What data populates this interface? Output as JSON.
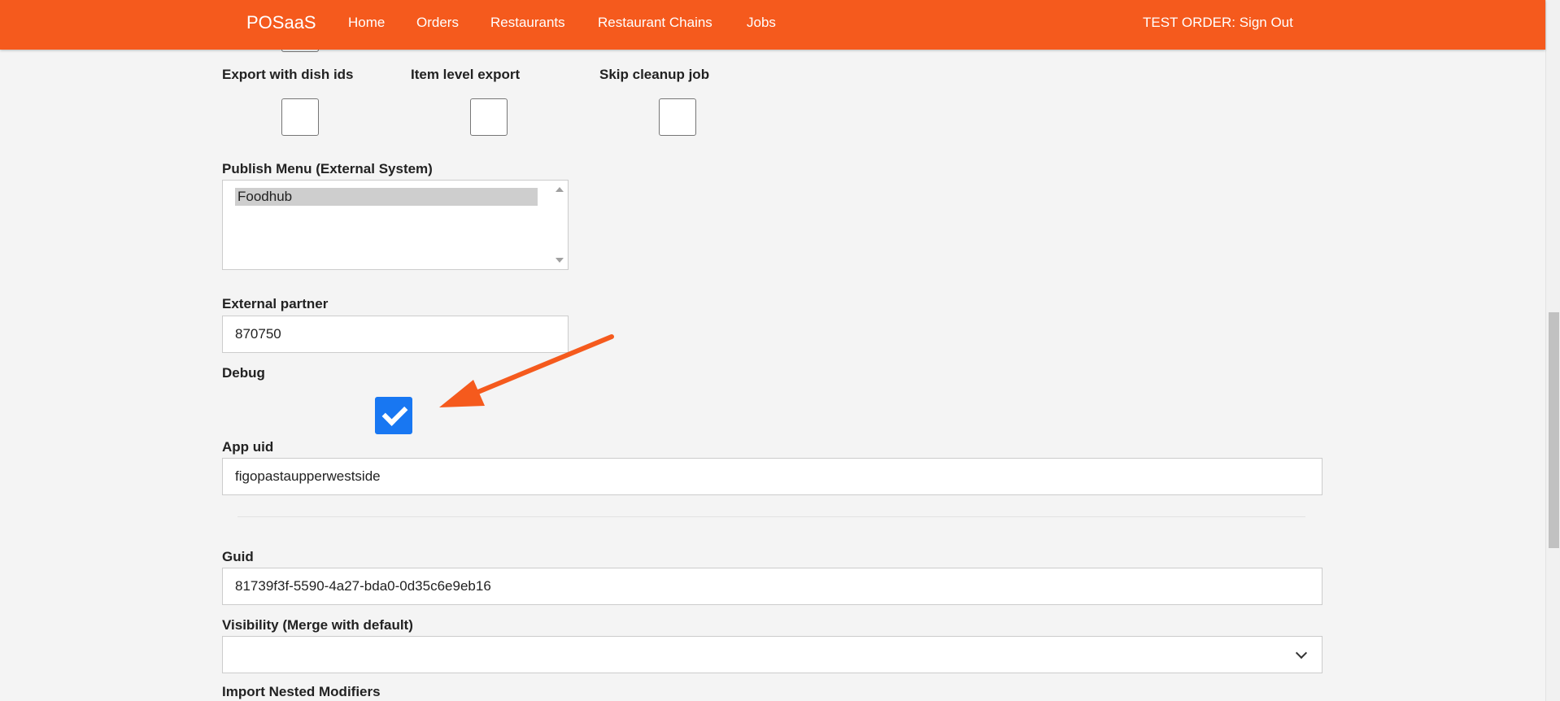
{
  "nav": {
    "brand": "POSaaS",
    "links": [
      "Home",
      "Orders",
      "Restaurants",
      "Restaurant Chains",
      "Jobs"
    ],
    "account": "TEST ORDER: Sign Out"
  },
  "form": {
    "export_with_dish_ids": {
      "label": "Export with dish ids",
      "checked": false
    },
    "item_level_export": {
      "label": "Item level export",
      "checked": false
    },
    "skip_cleanup_job": {
      "label": "Skip cleanup job",
      "checked": false
    },
    "publish_menu": {
      "label": "Publish Menu (External System)",
      "options": [
        "Foodhub"
      ],
      "selected": "Foodhub"
    },
    "external_partner": {
      "label": "External partner",
      "value": "870750"
    },
    "debug": {
      "label": "Debug",
      "checked": true
    },
    "app_uid": {
      "label": "App uid",
      "value": "figopastaupperwestside"
    },
    "guid": {
      "label": "Guid",
      "value": "81739f3f-5590-4a27-bda0-0d35c6e9eb16"
    },
    "visibility": {
      "label": "Visibility (Merge with default)",
      "value": ""
    },
    "import_nested_modifiers": {
      "label": "Import Nested Modifiers"
    }
  },
  "colors": {
    "navbar": "#f55a1d",
    "checkbox_checked": "#1877f2",
    "annotation_arrow": "#f55a1d"
  },
  "icons": {
    "checkmark": "check-icon",
    "annotation": "arrow-icon",
    "select": "chevron-down-icon"
  }
}
